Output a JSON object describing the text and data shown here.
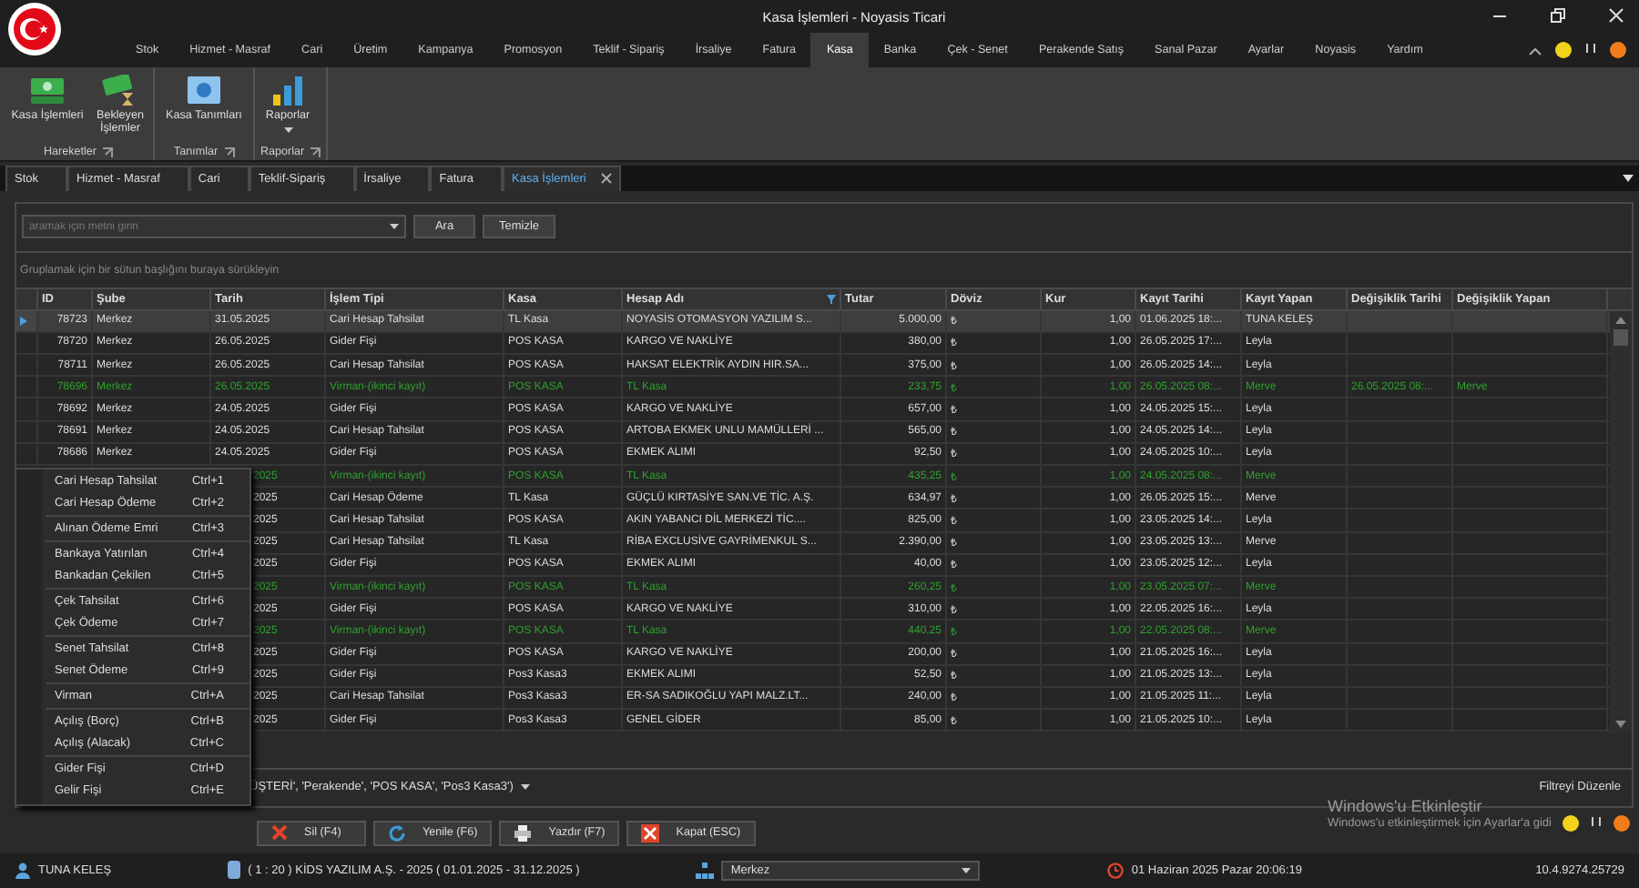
{
  "window": {
    "title": "Kasa İşlemleri - Noyasis Ticari"
  },
  "menu_tabs": [
    {
      "label": "Stok",
      "selected": false
    },
    {
      "label": "Hizmet - Masraf",
      "selected": false
    },
    {
      "label": "Cari",
      "selected": false
    },
    {
      "label": "Üretim",
      "selected": false
    },
    {
      "label": "Kampanya",
      "selected": false
    },
    {
      "label": "Promosyon",
      "selected": false
    },
    {
      "label": "Teklif - Sipariş",
      "selected": false
    },
    {
      "label": "İrsaliye",
      "selected": false
    },
    {
      "label": "Fatura",
      "selected": false
    },
    {
      "label": "Kasa",
      "selected": true
    },
    {
      "label": "Banka",
      "selected": false
    },
    {
      "label": "Çek - Senet",
      "selected": false
    },
    {
      "label": "Perakende Satış",
      "selected": false
    },
    {
      "label": "Sanal Pazar",
      "selected": false
    },
    {
      "label": "Ayarlar",
      "selected": false
    },
    {
      "label": "Noyasis",
      "selected": false
    },
    {
      "label": "Yardım",
      "selected": false
    }
  ],
  "ribbon": [
    {
      "label": "Hareketler",
      "buttons": [
        {
          "label": "Kasa İşlemleri",
          "kind": "money"
        },
        {
          "label": "Bekleyen İşlemler",
          "kind": "pending"
        }
      ]
    },
    {
      "label": "Tanımlar",
      "buttons": [
        {
          "label": "Kasa Tanımları",
          "kind": "safe"
        }
      ]
    },
    {
      "label": "Raporlar",
      "buttons": [
        {
          "label": "Raporlar",
          "kind": "chart"
        }
      ]
    }
  ],
  "doc_tabs": [
    {
      "label": "Stok",
      "selected": false
    },
    {
      "label": "Hizmet - Masraf",
      "selected": false
    },
    {
      "label": "Cari",
      "selected": false
    },
    {
      "label": "Teklif-Sipariş",
      "selected": false
    },
    {
      "label": "İrsaliye",
      "selected": false
    },
    {
      "label": "Fatura",
      "selected": false
    },
    {
      "label": "Kasa İşlemleri",
      "selected": true
    }
  ],
  "search": {
    "placeholder": "aramak için metni girin",
    "buttons": [
      "Ara",
      "Temizle"
    ]
  },
  "group_hint": "Gruplamak için bir sütun başlığını buraya sürükleyin",
  "table": {
    "columns": [
      "ID",
      "Şube",
      "Tarih",
      "İşlem Tipi",
      "Kasa",
      "Hesap Adı",
      "Tutar",
      "Döviz",
      "Kur",
      "Kayıt Tarihi",
      "Kayıt Yapan",
      "Değişiklik Tarihi",
      "Değişiklik Yapan"
    ],
    "rows": [
      {
        "selected": true,
        "linked": false,
        "id": "78723",
        "sube": "Merkez",
        "tarih": "31.05.2025",
        "islem": "Cari Hesap Tahsilat",
        "kasa": "TL Kasa",
        "hesap": "NOYASİS OTOMASYON YAZILIM S...",
        "tutar": "5.000,00",
        "doviz": "₺",
        "kur": "1,00",
        "kayit_tarihi": "01.06.2025 18:...",
        "kayit_yapan": "TUNA KELEŞ"
      },
      {
        "selected": false,
        "linked": false,
        "id": "78720",
        "sube": "Merkez",
        "tarih": "26.05.2025",
        "islem": "Gider Fişi",
        "kasa": "POS KASA",
        "hesap": "KARGO VE NAKLİYE",
        "tutar": "380,00",
        "doviz": "₺",
        "kur": "1,00",
        "kayit_tarihi": "26.05.2025 17:...",
        "kayit_yapan": "Leyla"
      },
      {
        "selected": false,
        "linked": false,
        "id": "78711",
        "sube": "Merkez",
        "tarih": "26.05.2025",
        "islem": "Cari Hesap Tahsilat",
        "kasa": "POS KASA",
        "hesap": "HAKSAT ELEKTRİK AYDIN HIR.SA...",
        "tutar": "375,00",
        "doviz": "₺",
        "kur": "1,00",
        "kayit_tarihi": "26.05.2025 14:...",
        "kayit_yapan": "Leyla"
      },
      {
        "selected": false,
        "linked": true,
        "id": "78696",
        "sube": "Merkez",
        "tarih": "26.05.2025",
        "islem": "Virman-(ikinci kayıt)",
        "kasa": "POS KASA",
        "hesap": "TL Kasa",
        "tutar": "233,75",
        "doviz": "₺",
        "kur": "1,00",
        "kayit_tarihi": "26.05.2025 08:...",
        "kayit_yapan": "Merve",
        "degisiklik_tarihi": "26.05.2025 08:...",
        "degisiklik_yapan": "Merve"
      },
      {
        "selected": false,
        "linked": false,
        "id": "78692",
        "sube": "Merkez",
        "tarih": "24.05.2025",
        "islem": "Gider Fişi",
        "kasa": "POS KASA",
        "hesap": "KARGO VE NAKLİYE",
        "tutar": "657,00",
        "doviz": "₺",
        "kur": "1,00",
        "kayit_tarihi": "24.05.2025 15:...",
        "kayit_yapan": "Leyla"
      },
      {
        "selected": false,
        "linked": false,
        "id": "78691",
        "sube": "Merkez",
        "tarih": "24.05.2025",
        "islem": "Cari Hesap Tahsilat",
        "kasa": "POS KASA",
        "hesap": "ARTOBA EKMEK UNLU MAMÜLLERİ ...",
        "tutar": "565,00",
        "doviz": "₺",
        "kur": "1,00",
        "kayit_tarihi": "24.05.2025 14:...",
        "kayit_yapan": "Leyla"
      },
      {
        "selected": false,
        "linked": false,
        "id": "78686",
        "sube": "Merkez",
        "tarih": "24.05.2025",
        "islem": "Gider Fişi",
        "kasa": "POS KASA",
        "hesap": "EKMEK ALIMI",
        "tutar": "92,50",
        "doviz": "₺",
        "kur": "1,00",
        "kayit_tarihi": "24.05.2025 10:...",
        "kayit_yapan": "Leyla"
      },
      {
        "selected": false,
        "linked": true,
        "tarih": "2025",
        "islem": "Virman-(ikinci kayıt)",
        "kasa": "POS KASA",
        "hesap": "TL Kasa",
        "tutar": "435,25",
        "doviz": "₺",
        "kur": "1,00",
        "kayit_tarihi": "24.05.2025 08:...",
        "kayit_yapan": "Merve"
      },
      {
        "selected": false,
        "linked": false,
        "tarih": "2025",
        "islem": "Cari Hesap Ödeme",
        "kasa": "TL Kasa",
        "hesap": "GÜÇLÜ KIRTASİYE SAN.VE TİC. A.Ş.",
        "tutar": "634,97",
        "doviz": "₺",
        "kur": "1,00",
        "kayit_tarihi": "26.05.2025 15:...",
        "kayit_yapan": "Merve"
      },
      {
        "selected": false,
        "linked": false,
        "tarih": "2025",
        "islem": "Cari Hesap Tahsilat",
        "kasa": "POS KASA",
        "hesap": "AKIN YABANCI DİL MERKEZİ TİC....",
        "tutar": "825,00",
        "doviz": "₺",
        "kur": "1,00",
        "kayit_tarihi": "23.05.2025 14:...",
        "kayit_yapan": "Leyla"
      },
      {
        "selected": false,
        "linked": false,
        "tarih": "2025",
        "islem": "Cari Hesap Tahsilat",
        "kasa": "TL Kasa",
        "hesap": "RİBA EXCLUSİVE GAYRİMENKUL S...",
        "tutar": "2.390,00",
        "doviz": "₺",
        "kur": "1,00",
        "kayit_tarihi": "23.05.2025 13:...",
        "kayit_yapan": "Merve"
      },
      {
        "selected": false,
        "linked": false,
        "tarih": "2025",
        "islem": "Gider Fişi",
        "kasa": "POS KASA",
        "hesap": "EKMEK ALIMI",
        "tutar": "40,00",
        "doviz": "₺",
        "kur": "1,00",
        "kayit_tarihi": "23.05.2025 12:...",
        "kayit_yapan": "Leyla"
      },
      {
        "selected": false,
        "linked": true,
        "tarih": "2025",
        "islem": "Virman-(ikinci kayıt)",
        "kasa": "POS KASA",
        "hesap": "TL Kasa",
        "tutar": "260,25",
        "doviz": "₺",
        "kur": "1,00",
        "kayit_tarihi": "23.05.2025 07:...",
        "kayit_yapan": "Merve"
      },
      {
        "selected": false,
        "linked": false,
        "tarih": "2025",
        "islem": "Gider Fişi",
        "kasa": "POS KASA",
        "hesap": "KARGO VE NAKLİYE",
        "tutar": "310,00",
        "doviz": "₺",
        "kur": "1,00",
        "kayit_tarihi": "22.05.2025 16:...",
        "kayit_yapan": "Leyla"
      },
      {
        "selected": false,
        "linked": true,
        "tarih": "2025",
        "islem": "Virman-(ikinci kayıt)",
        "kasa": "POS KASA",
        "hesap": "TL Kasa",
        "tutar": "440,25",
        "doviz": "₺",
        "kur": "1,00",
        "kayit_tarihi": "22.05.2025 08:...",
        "kayit_yapan": "Merve"
      },
      {
        "selected": false,
        "linked": false,
        "tarih": "2025",
        "islem": "Gider Fişi",
        "kasa": "POS KASA",
        "hesap": "KARGO VE NAKLİYE",
        "tutar": "200,00",
        "doviz": "₺",
        "kur": "1,00",
        "kayit_tarihi": "21.05.2025 16:...",
        "kayit_yapan": "Leyla"
      },
      {
        "selected": false,
        "linked": false,
        "tarih": "2025",
        "islem": "Gider Fişi",
        "kasa": "Pos3 Kasa3",
        "hesap": "EKMEK ALIMI",
        "tutar": "52,50",
        "doviz": "₺",
        "kur": "1,00",
        "kayit_tarihi": "21.05.2025 13:...",
        "kayit_yapan": "Leyla"
      },
      {
        "selected": false,
        "linked": false,
        "tarih": "2025",
        "islem": "Cari Hesap Tahsilat",
        "kasa": "Pos3 Kasa3",
        "hesap": "ER-SA SADIKOĞLU YAPI MALZ.LT...",
        "tutar": "240,00",
        "doviz": "₺",
        "kur": "1,00",
        "kayit_tarihi": "21.05.2025 11:...",
        "kayit_yapan": "Leyla"
      },
      {
        "selected": false,
        "linked": false,
        "tarih": "2025",
        "islem": "Gider Fişi",
        "kasa": "Pos3 Kasa3",
        "hesap": "GENEL GİDER",
        "tutar": "85,00",
        "doviz": "₺",
        "kur": "1,00",
        "kayit_tarihi": "21.05.2025 10:...",
        "kayit_yapan": "Leyla"
      }
    ]
  },
  "context_menu": [
    [
      {
        "label": "Cari Hesap Tahsilat",
        "shortcut": "Ctrl+1"
      },
      {
        "label": "Cari Hesap Ödeme",
        "shortcut": "Ctrl+2"
      }
    ],
    [
      {
        "label": "Alınan Ödeme Emri",
        "shortcut": "Ctrl+3"
      }
    ],
    [
      {
        "label": "Bankaya Yatırılan",
        "shortcut": "Ctrl+4"
      },
      {
        "label": "Bankadan Çekilen",
        "shortcut": "Ctrl+5"
      }
    ],
    [
      {
        "label": "Çek Tahsilat",
        "shortcut": "Ctrl+6"
      },
      {
        "label": "Çek Ödeme",
        "shortcut": "Ctrl+7"
      }
    ],
    [
      {
        "label": "Senet Tahsilat",
        "shortcut": "Ctrl+8"
      },
      {
        "label": "Senet Ödeme",
        "shortcut": "Ctrl+9"
      }
    ],
    [
      {
        "label": "Virman",
        "shortcut": "Ctrl+A"
      }
    ],
    [
      {
        "label": "Açılış (Borç)",
        "shortcut": "Ctrl+B"
      },
      {
        "label": "Açılış (Alacak)",
        "shortcut": "Ctrl+C"
      }
    ],
    [
      {
        "label": "Gider Fişi",
        "shortcut": "Ctrl+D"
      },
      {
        "label": "Gelir Fişi",
        "shortcut": "Ctrl+E"
      }
    ]
  ],
  "filter": {
    "text": "ÜŞTERİ', 'Perakende', 'POS KASA', 'Pos3 Kasa3')",
    "edit": "Filtreyi Düzenle"
  },
  "actions": [
    {
      "label": "Sil (F4)",
      "kind": "delete"
    },
    {
      "label": "Yenile (F6)",
      "kind": "refresh"
    },
    {
      "label": "Yazdır (F7)",
      "kind": "print"
    },
    {
      "label": "Kapat (ESC)",
      "kind": "close"
    }
  ],
  "activation": {
    "title": "Windows'u Etkinleştir",
    "text": "Windows'u etkinleştirmek için Ayarlar'a gidi"
  },
  "status_bar": {
    "user": "TUNA KELEŞ",
    "company": "( 1 : 20 )  KİDS YAZILIM A.Ş. - 2025  ( 01.01.2025 - 31.12.2025 )",
    "branch": "Merkez",
    "datetime": "01 Haziran 2025 Pazar 20:06:19",
    "version": "10.4.9274.25729"
  }
}
